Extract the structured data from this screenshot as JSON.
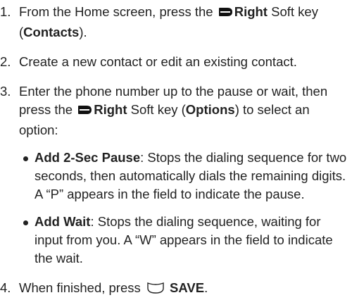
{
  "steps": [
    {
      "num": "1.",
      "before": "From the Home screen, press the ",
      "key": "Right",
      "middle": " Soft key (",
      "bold2": "Contacts",
      "after": ")."
    },
    {
      "num": "2.",
      "text": "Create a new contact or edit an existing contact."
    },
    {
      "num": "3.",
      "before": "Enter the phone number up to the pause or wait, then press the ",
      "key": "Right",
      "middle": " Soft key (",
      "bold2": "Options",
      "after": ") to select an option:",
      "bullets": [
        {
          "title": "Add 2-Sec Pause",
          "text": ": Stops the dialing sequence for two seconds, then automatically dials the remaining digits. A “P” appears in the field to indicate the pause."
        },
        {
          "title": "Add Wait",
          "text": ": Stops the dialing sequence, waiting for input from you. A “W” appears in the field to indicate the wait."
        }
      ]
    },
    {
      "num": "4.",
      "before": "When finished, press ",
      "key": "SAVE",
      "after": "."
    }
  ],
  "icons": {
    "right_soft_key": "right-soft-key-icon",
    "center_key": "center-select-key-icon"
  }
}
